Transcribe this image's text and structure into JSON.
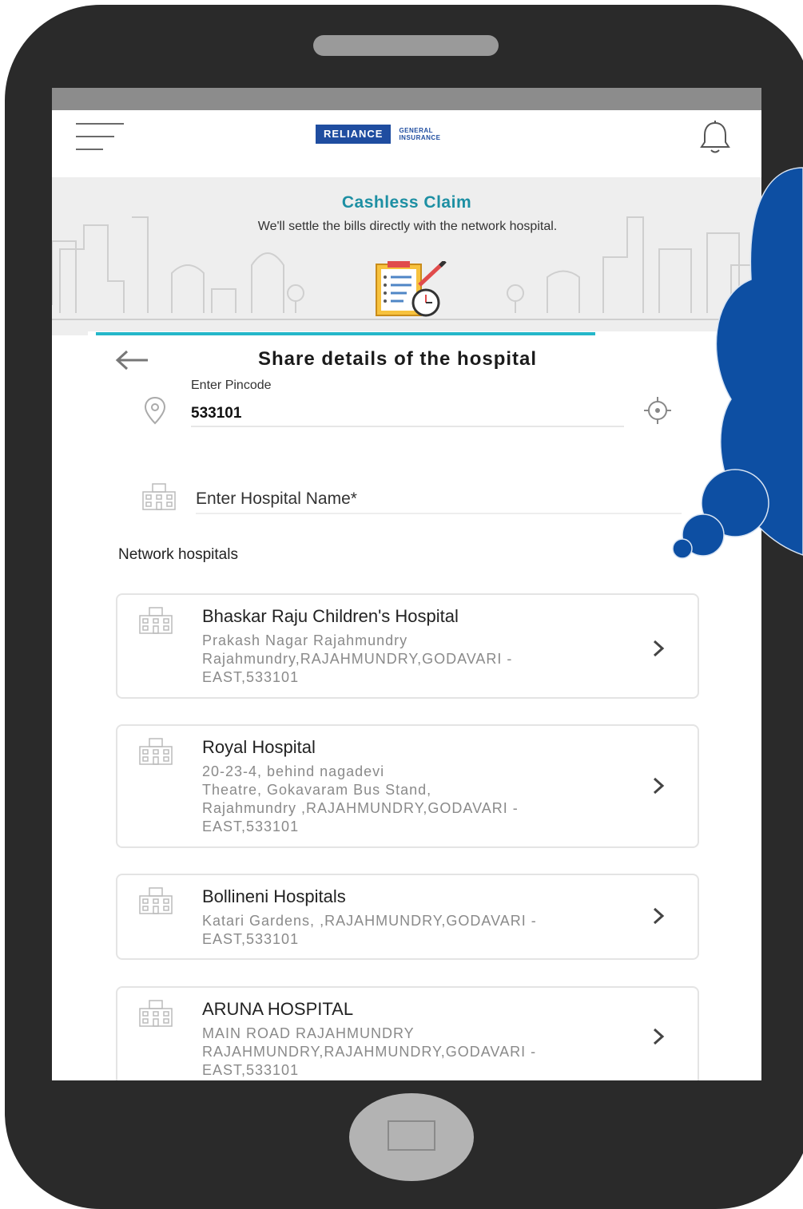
{
  "header": {
    "brand_word": "RELIANCE",
    "brand_sub_line1": "GENERAL",
    "brand_sub_line2": "INSURANCE"
  },
  "banner": {
    "title": "Cashless Claim",
    "subtitle": "We'll settle the bills directly with the network hospital."
  },
  "form": {
    "section_title": "Share details of the hospital",
    "pincode_label": "Enter Pincode",
    "pincode_value": "533101",
    "hospital_name_placeholder": "Enter Hospital Name*"
  },
  "network_label": "Network hospitals",
  "hospitals": [
    {
      "name": "Bhaskar Raju Children's Hospital",
      "address": [
        "Prakash Nagar Rajahmundry",
        "Rajahmundry,RAJAHMUNDRY,GODAVARI -",
        "EAST,533101"
      ]
    },
    {
      "name": "Royal Hospital",
      "address": [
        "20-23-4, behind nagadevi",
        "Theatre, Gokavaram Bus Stand,",
        "Rajahmundry  ,RAJAHMUNDRY,GODAVARI -",
        "EAST,533101"
      ]
    },
    {
      "name": "Bollineni Hospitals",
      "address": [
        "Katari Gardens,  ,RAJAHMUNDRY,GODAVARI -",
        "EAST,533101"
      ]
    },
    {
      "name": "ARUNA HOSPITAL",
      "address": [
        "MAIN ROAD RAJAHMUNDRY",
        "RAJAHMUNDRY,RAJAHMUNDRY,GODAVARI -",
        "EAST,533101"
      ]
    }
  ],
  "icons": {
    "menu": "hamburger-menu-icon",
    "notification": "bell-icon",
    "back": "back-arrow-icon",
    "location": "location-pin-icon",
    "gps": "gps-target-icon",
    "hospital": "hospital-building-icon",
    "open": "chevron-right-icon"
  },
  "colors": {
    "brand_blue": "#1f4da0",
    "accent_teal": "#1d8fa3",
    "progress": "#25b7c9",
    "bubble": "#0d4fa3",
    "phone_frame": "#2a2a2a"
  }
}
